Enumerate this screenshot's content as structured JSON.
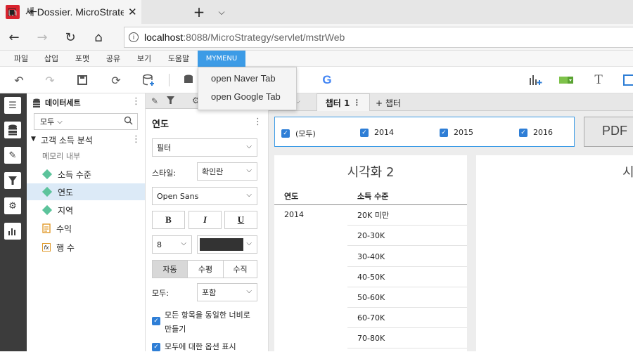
{
  "browser": {
    "tab_title": "새 Dossier. MicroStrategy",
    "tab_logo": "m",
    "url_host": "localhost",
    "url_path": ":8088/MicroStrategy/servlet/mstrWeb"
  },
  "menu": {
    "items": [
      "파일",
      "삽입",
      "포맷",
      "공유",
      "보기",
      "도움말"
    ],
    "mymenu": "MYMENU",
    "dropdown": [
      "open Naver Tab",
      "open Google Tab"
    ]
  },
  "toolbar": {
    "google_letter": "G",
    "text_icon": "T"
  },
  "dataset": {
    "header": "데이터세트",
    "search_value": "모두",
    "dataset_name": "고객 소득 분석",
    "memory_label": "메모리 내부",
    "items": [
      {
        "label": "소득 수준",
        "type": "attribute"
      },
      {
        "label": "연도",
        "type": "attribute"
      },
      {
        "label": "지역",
        "type": "attribute"
      },
      {
        "label": "수익",
        "type": "metric"
      },
      {
        "label": "행 수",
        "type": "derived"
      }
    ]
  },
  "format": {
    "title": "연도",
    "display_select": "필터",
    "style_label": "스타일:",
    "style_value": "확인란",
    "font_value": "Open Sans",
    "bold": "B",
    "italic": "I",
    "underline": "U",
    "font_size": "8",
    "orientation": [
      "자동",
      "수평",
      "수직"
    ],
    "all_label": "모두:",
    "all_value": "포함",
    "option1": "모든 항목을 동일한 너비로 만들기",
    "option2": "모두에 대한 옵션 표시"
  },
  "canvas": {
    "chapter_tab": "챕터 1",
    "add_chapter": "+ 챕터",
    "filter_items": [
      "(모두)",
      "2014",
      "2015",
      "2016"
    ],
    "pdf_label": "PDF",
    "viz_title": "시각화 2",
    "viz2_title": "시",
    "table": {
      "headers": [
        "연도",
        "소득 수준"
      ],
      "year": "2014",
      "rows": [
        "20K 미만",
        "20-30K",
        "30-40K",
        "40-50K",
        "50-60K",
        "60-70K",
        "70-80K"
      ]
    }
  }
}
